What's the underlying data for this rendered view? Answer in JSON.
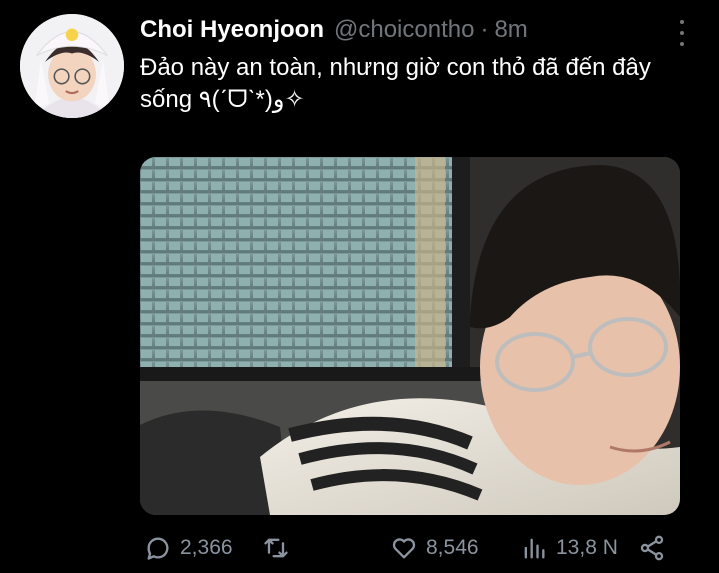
{
  "tweet": {
    "author_name": "Choi Hyeonjoon",
    "author_handle": "@choicontho",
    "separator": "·",
    "time_ago": "8m",
    "text": "Đảo này an toàn, nhưng giờ con thỏ đã đến đây sống ٩(ˊᗜˋ*)و✧"
  },
  "actions": {
    "reply_count": "2,366",
    "retweet_count": "",
    "like_count": "8,546",
    "view_count": "13,8 N"
  },
  "icons": {
    "more": "more-vertical-icon",
    "reply": "reply-icon",
    "retweet": "retweet-icon",
    "like": "heart-icon",
    "views": "views-icon",
    "share": "share-icon"
  },
  "colors": {
    "background": "#000000",
    "primary_text": "#ffffff",
    "secondary_text": "#71767b"
  }
}
